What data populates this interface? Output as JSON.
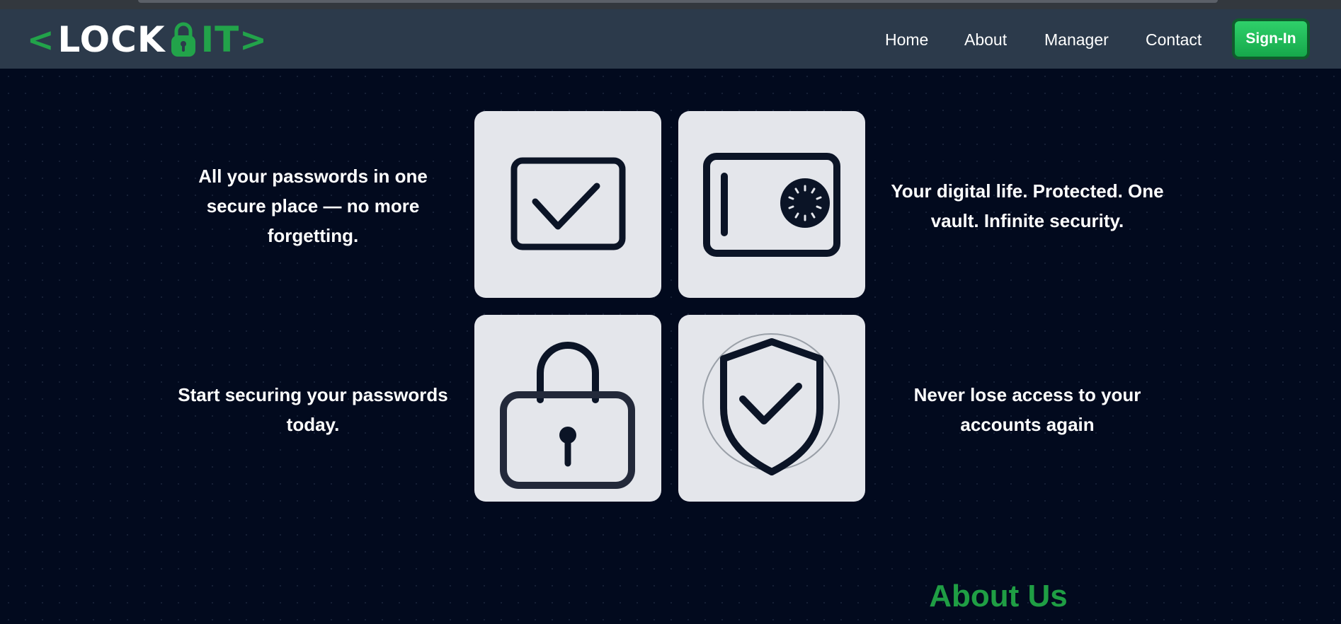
{
  "brand": {
    "bracket_open": "<",
    "word_lock": "LOCK",
    "word_it": "IT",
    "bracket_close": ">",
    "lock_icon": "padlock-icon"
  },
  "nav": {
    "links": [
      "Home",
      "About",
      "Manager",
      "Contact"
    ],
    "signin_label": "Sign-In"
  },
  "features": {
    "top_left_caption": "All your passwords in one secure place — no more forgetting.",
    "top_right_caption": "Your digital life. Protected. One vault. Infinite security.",
    "bottom_left_caption": "Start securing your passwords today.",
    "bottom_right_caption": "Never lose access to your accounts again",
    "tiles": [
      {
        "icon": "checkbox-icon"
      },
      {
        "icon": "safe-vault-icon"
      },
      {
        "icon": "padlock-icon"
      },
      {
        "icon": "shield-check-icon"
      }
    ]
  },
  "about": {
    "title": "About Us"
  },
  "colors": {
    "background": "#020a1e",
    "navbar": "#2c3a4b",
    "accent": "#22a34a",
    "tile": "#e4e6eb",
    "icon": "#0b1426"
  }
}
